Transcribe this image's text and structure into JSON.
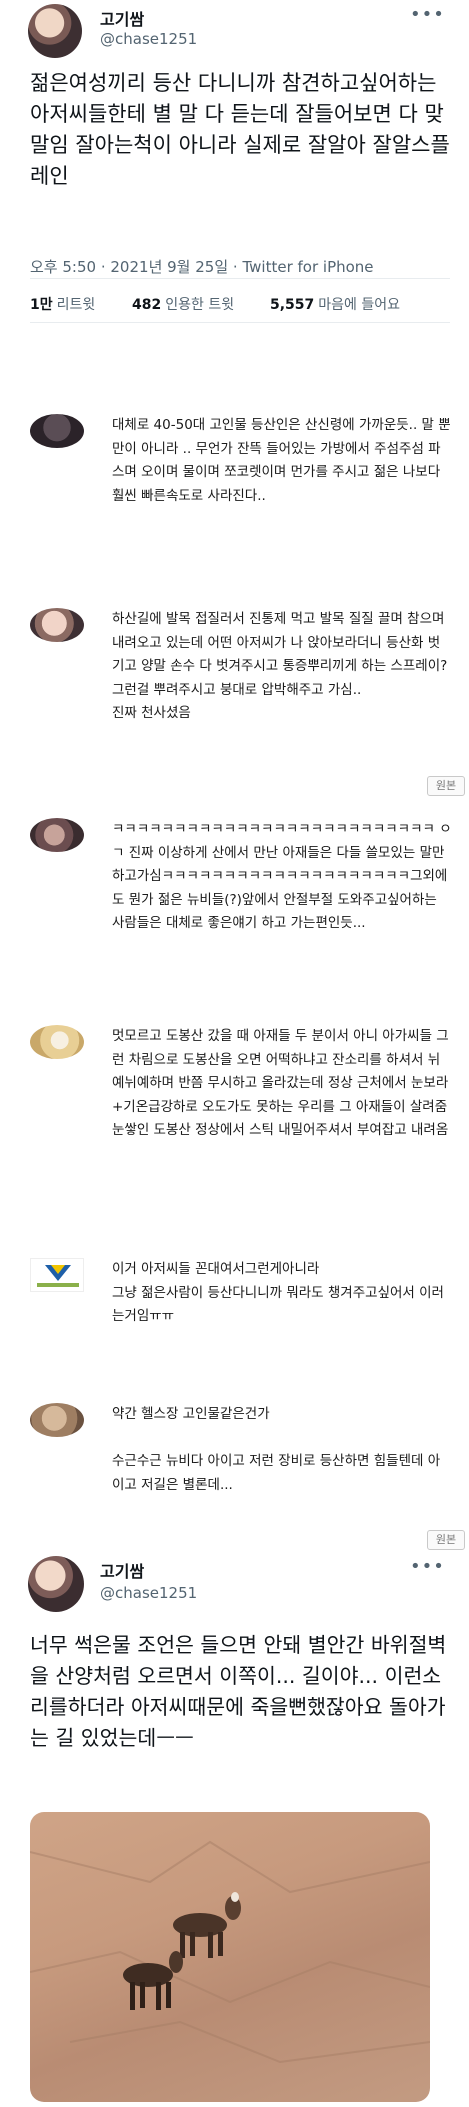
{
  "tweet": {
    "author": {
      "name": "고기쌈",
      "handle": "@chase1251"
    },
    "text": "젊은여성끼리 등산 다니니까 참견하고싶어하는 아저씨들한테 별 말 다 듣는데 잘들어보면 다 맞말임 잘아는척이 아니라 실제로 잘알아 잘알스플레인",
    "time": "오후 5:50",
    "date": "2021년 9월 25일",
    "source": "Twitter for iPhone",
    "stats": [
      {
        "count": "1만",
        "label": "리트윗"
      },
      {
        "count": "482",
        "label": "인용한 트윗"
      },
      {
        "count": "5,557",
        "label": "마음에 들어요"
      }
    ]
  },
  "origin_label": "원본",
  "comments": [
    {
      "text": "대체로 40-50대 고인물 등산인은 산신령에 가까운듯.. 말 뿐만이 아니라 .. 무언가 잔뜩 들어있는 가방에서 주섬주섬 파스며 오이며 물이며 쪼코렛이며 먼가를 주시고 젊은 나보다 훨씬 빠른속도로 사라진다.."
    },
    {
      "text": "하산길에 발목 접질러서 진통제 먹고 발목 질질 끌며 참으며 내려오고 있는데 어떤 아저씨가 나 앉아보라더니 등산화 벗기고 양말 손수 다 벗겨주시고 통증뿌리끼게 하는 스프레이? 그런걸 뿌려주시고 붕대로 압박해주고 가심..\n진짜 천사셨음"
    },
    {
      "text": "ㅋㅋㅋㅋㅋㅋㅋㅋㅋㅋㅋㅋㅋㅋㅋㅋㅋㅋㅋㅋㅋㅋㅋㅋㅋㅋ ㅇㄱ 진짜 이상하게 산에서 만난 아재들은 다들 쓸모있는 말만 하고가심ㅋㅋㅋㅋㅋㅋㅋㅋㅋㅋㅋㅋㅋㅋㅋㅋㅋㅋㅋㅋ그외에도 뭔가 젊은 뉴비들(?)앞에서 안절부절 도와주고싶어하는 사람들은 대체로 좋은얘기 하고 가는편인듯..."
    },
    {
      "text": "멋모르고 도봉산 갔을 때 아재들 두 분이서 아니 아가씨들 그런 차림으로 도봉산을 오면 어떡하냐고 잔소리를 하셔서 뉘예뉘예하며 반쯤 무시하고 올라갔는데 정상 근처에서 눈보라+기온급강하로 오도가도 못하는 우리를 그 아재들이 살려줌 눈쌓인 도봉산 정상에서 스틱 내밀어주셔서 부여잡고 내려옴"
    },
    {
      "text": "이거 아저씨들 꼰대여서그런게아니라\n그냥 젊은사람이 등산다니니까 뭐라도 챙겨주고싶어서 이러는거임ㅠㅠ"
    },
    {
      "text": "약간 헬스장 고인물같은건가\n\n수근수근 뉴비다 아이고 저런 장비로 등산하면 힘들텐데 아이고 저길은 별론데..."
    }
  ],
  "tweet2": {
    "author": {
      "name": "고기쌈",
      "handle": "@chase1251"
    },
    "text": "너무 썩은물 조언은 들으면 안돼 별안간 바위절벽을 산양처럼 오르면서 이쪽이... 길이야... 이런소리를하더라 아저씨때문에 죽을뻔했잖아요 돌아가는 길 있었는데ㅡㅡ"
  }
}
